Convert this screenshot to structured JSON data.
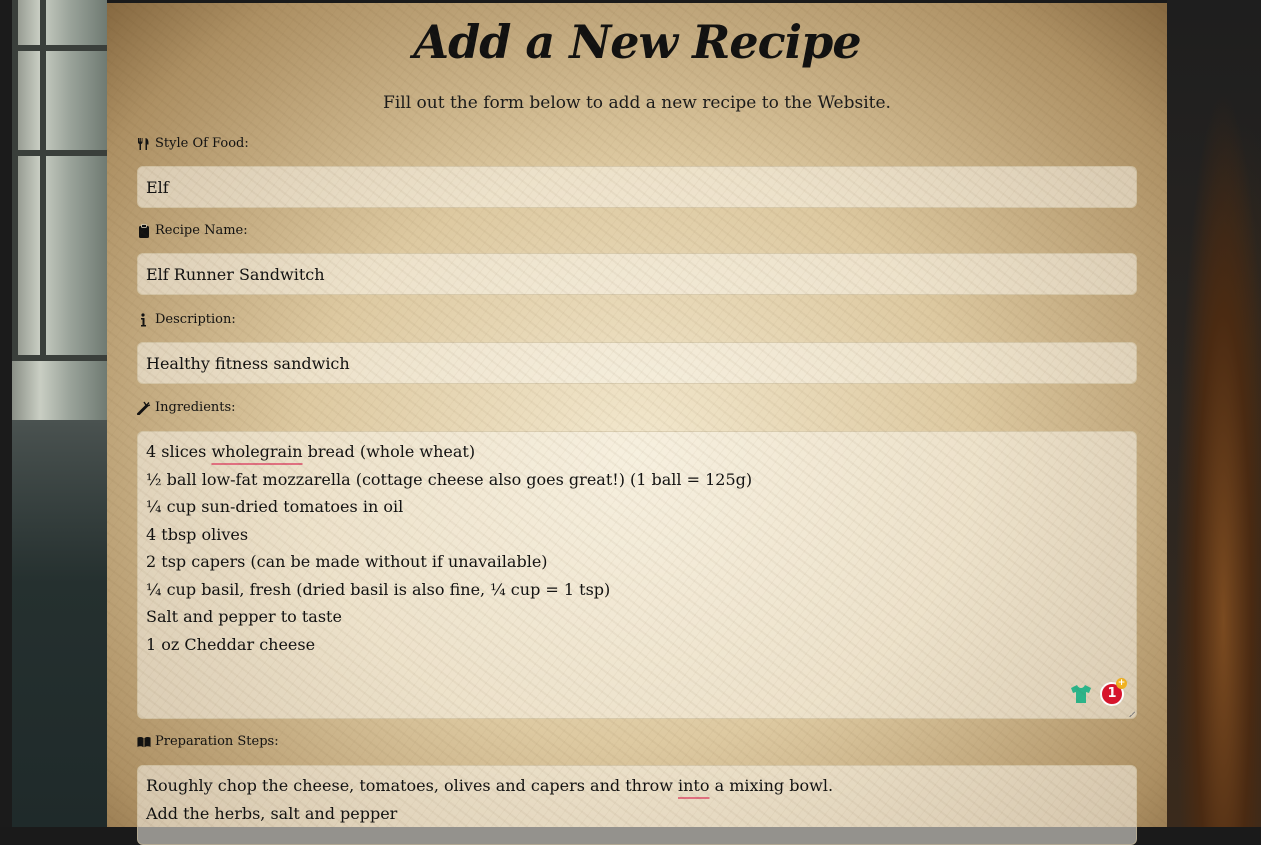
{
  "page": {
    "title": "Add a New Recipe",
    "subtitle": "Fill out the form below to add a new recipe to the Website."
  },
  "form": {
    "style": {
      "label": "Style Of Food:",
      "value": "Elf",
      "icon": "utensils-icon"
    },
    "name": {
      "label": "Recipe Name:",
      "value": "Elf Runner Sandwitch",
      "icon": "clipboard-icon"
    },
    "description": {
      "label": "Description:",
      "value": "Healthy fitness sandwich",
      "icon": "info-icon"
    },
    "ingredients": {
      "label": "Ingredients:",
      "icon": "carrot-icon",
      "lines": [
        "4 slices wholegrain bread (whole wheat)",
        "½ ball low-fat mozzarella (cottage cheese also goes great!) (1 ball = 125g)",
        "¼ cup sun-dried tomatoes in oil",
        "4 tbsp olives",
        "2 tsp capers (can be made without if unavailable)",
        "¼ cup basil, fresh (dried basil is also fine, ¼ cup = 1 tsp)",
        "Salt and pepper to taste",
        "1 oz Cheddar cheese"
      ],
      "misspelled": "wholegrain"
    },
    "steps": {
      "label": "Preparation Steps:",
      "icon": "book-open-icon",
      "lines": [
        "Roughly chop the cheese, tomatoes, olives and capers and throw into a mixing bowl.",
        "Add the herbs, salt and pepper"
      ],
      "misspelled": "into"
    }
  },
  "extension": {
    "badge_count": "1",
    "badge_plus": "+",
    "badge_color": "#d8142c",
    "shirt_color": "#2bb58a"
  }
}
